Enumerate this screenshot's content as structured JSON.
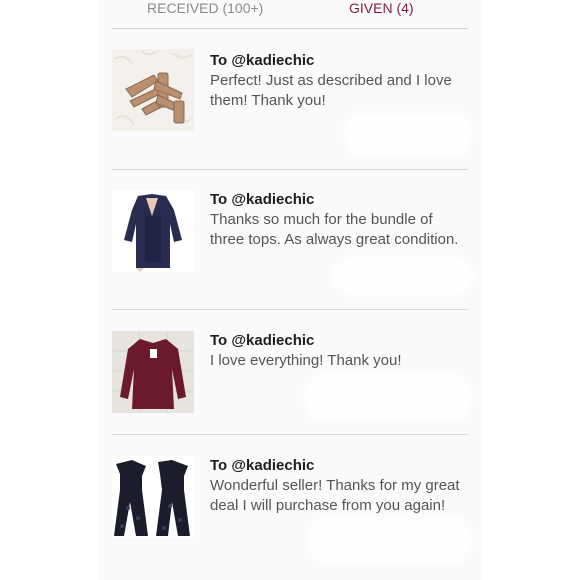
{
  "tabs": {
    "received": "RECEIVED (100+)",
    "given": "GIVEN (4)"
  },
  "reviews": [
    {
      "to": "To @kadiechic",
      "message": "Perfect! Just as described and I love them! Thank you!",
      "image": "sandals-photo"
    },
    {
      "to": "To @kadiechic",
      "message": "Thanks so much for the bundle of three tops. As always great condition.",
      "image": "navy-cardigan-photo"
    },
    {
      "to": "To @kadiechic",
      "message": "I love everything! Thank you!",
      "image": "burgundy-top-photo"
    },
    {
      "to": "To @kadiechic",
      "message": "Wonderful seller! Thanks for my great deal I will purchase from you again!",
      "image": "jumpsuit-photo"
    }
  ],
  "colors": {
    "accent": "#7f1e3a",
    "tab_inactive": "#8a8a8a",
    "text_dark": "#1e1e1e",
    "text_body": "#555555"
  }
}
